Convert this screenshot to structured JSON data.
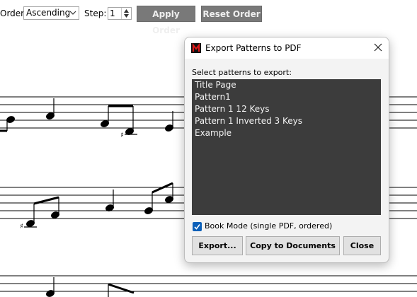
{
  "toolbar": {
    "order_label": "Order:",
    "order_value": "Ascending",
    "step_label": "Step:",
    "step_value": "1",
    "apply_label": "Apply Order",
    "reset_label": "Reset Order",
    "button_color": "#797979"
  },
  "dialog": {
    "title": "Export Patterns to PDF",
    "prompt": "Select patterns to export:",
    "items": [
      "Title Page",
      "Pattern1",
      "Pattern 1 12 Keys",
      "Pattern 1 Inverted 3 Keys",
      "Example"
    ],
    "book_mode_label": "Book Mode (single PDF, ordered)",
    "book_mode_checked": true,
    "export_label": "Export...",
    "copy_label": "Copy to Documents",
    "close_label": "Close",
    "accent_color": "#0b5fb8",
    "list_bg": "#3c3c3c",
    "icons": [
      "app-logo-icon",
      "close-icon",
      "checkbox-check-icon"
    ]
  }
}
